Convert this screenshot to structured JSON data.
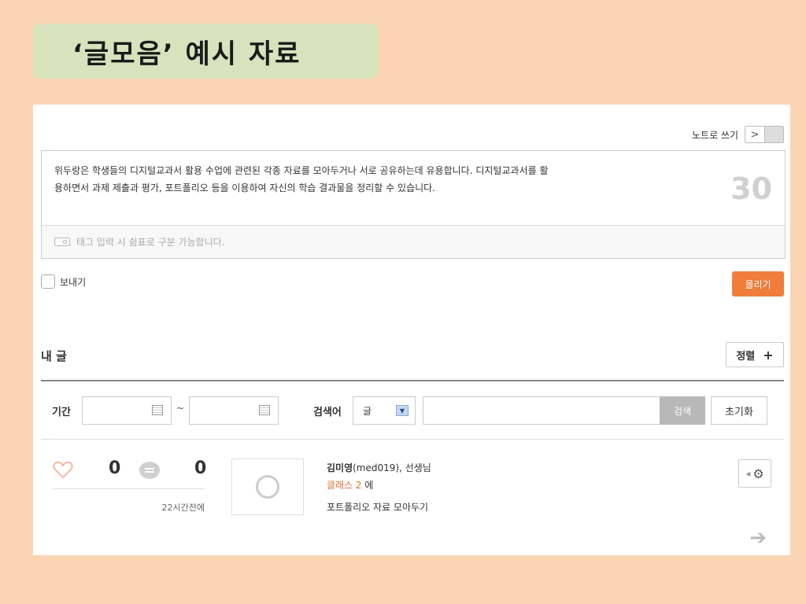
{
  "slide_title": "‘글모음’ 예시 자료",
  "toolbar": {
    "note_write_label": "노트로 쓰기",
    "toggle_glyph": ">"
  },
  "editor": {
    "text_line1": "위두랑은 학생들의 디지털교과서 활용 수업에 관련된 각종 자료를 모아두거나 서로 공유하는데 유용합니다. 디지털교과서를 활",
    "text_line2": "용하면서 과제 제출과 평가, 포트폴리오 등을 이용하여 자신의 학습 결과물을 정리할 수 있습니다.",
    "char_count": "30",
    "tag_placeholder": "태그 입력 시 쉼표로 구분 가능합니다."
  },
  "send_label": "보내기",
  "upload_label": "올리기",
  "my_posts": {
    "title": "내 글",
    "sort_label": "정렬",
    "sort_plus": "+"
  },
  "filters": {
    "period_label": "기간",
    "tilde": "~",
    "search_label": "검색어",
    "search_type": "글",
    "search_button": "검색",
    "reset_button": "초기화"
  },
  "post": {
    "likes": "0",
    "comments": "0",
    "time": "22시간전에",
    "author": "김미영",
    "author_suffix": "(med019), 선생님",
    "class_name": "클래스 2",
    "class_suffix": " 에",
    "body": "포트폴리오 자료 모아두기"
  },
  "colors": {
    "background": "#fbd4b4",
    "title_box": "#d6e3bc",
    "upload": "#f07d3c",
    "class_link": "#e07030"
  },
  "icons": [
    "tag-icon",
    "calendar-icon",
    "dropdown-arrow-icon",
    "heart-icon",
    "comment-icon",
    "avatar-icon",
    "gear-icon",
    "arrow-right-icon"
  ]
}
